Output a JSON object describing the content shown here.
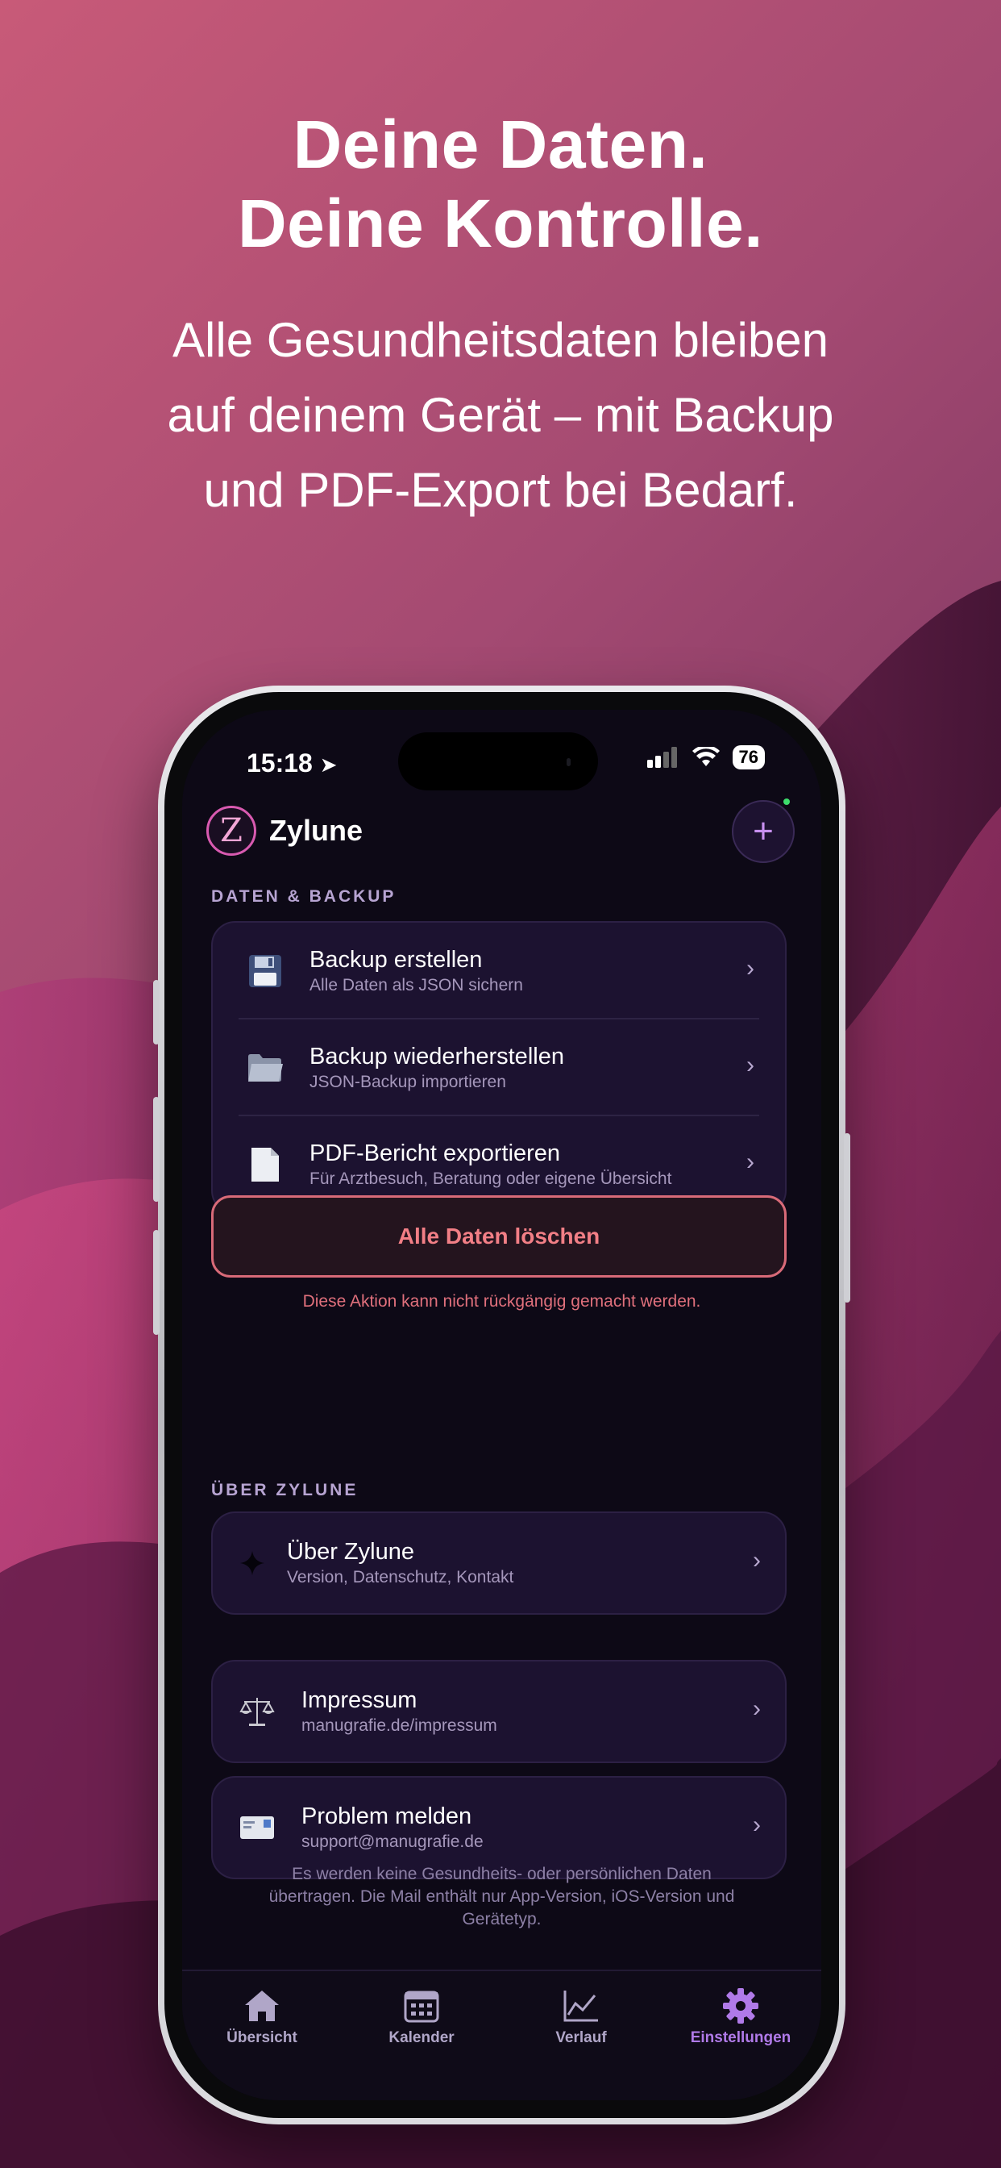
{
  "promo": {
    "headline_line1": "Deine Daten.",
    "headline_line2": "Deine Kontrolle.",
    "subline_line1": "Alle Gesundheitsdaten bleiben",
    "subline_line2": "auf deinem Gerät – mit Backup",
    "subline_line3": "und PDF-Export bei Bedarf."
  },
  "status_bar": {
    "time": "15:18",
    "battery": "76"
  },
  "app": {
    "logo_letter": "Z",
    "title": "Zylune",
    "add_label": "+"
  },
  "data_section": {
    "label": "DATEN & BACKUP",
    "items": [
      {
        "title": "Backup erstellen",
        "subtitle": "Alle Daten als JSON sichern",
        "icon": "floppy-disk-icon"
      },
      {
        "title": "Backup wiederherstellen",
        "subtitle": "JSON-Backup importieren",
        "icon": "folder-icon"
      },
      {
        "title": "PDF-Bericht exportieren",
        "subtitle": "Für Arztbesuch, Beratung oder eigene Übersicht",
        "icon": "document-icon"
      }
    ]
  },
  "danger": {
    "delete_label": "Alle Daten löschen",
    "delete_note": "Diese Aktion kann nicht rückgängig gemacht werden.",
    "color": "#f27f86"
  },
  "about_section": {
    "label": "ÜBER ZYLUNE",
    "about": {
      "title": "Über Zylune",
      "subtitle": "Version, Datenschutz, Kontakt",
      "icon": "sparkle-icon"
    },
    "imprint": {
      "title": "Impressum",
      "subtitle": "manugrafie.de/impressum",
      "icon": "scales-icon"
    },
    "report": {
      "title": "Problem melden",
      "subtitle": "support@manugrafie.de",
      "icon": "envelope-icon"
    },
    "note_line1": "Es werden keine Gesundheits- oder persönlichen Daten",
    "note_line2": "übertragen. Die Mail enthält nur App-Version, iOS-Version und",
    "note_line3": "Gerätetyp."
  },
  "tabs": [
    {
      "label": "Übersicht",
      "icon": "house-icon"
    },
    {
      "label": "Kalender",
      "icon": "calendar-icon"
    },
    {
      "label": "Verlauf",
      "icon": "chart-line-icon"
    },
    {
      "label": "Einstellungen",
      "icon": "gear-icon",
      "active": true
    }
  ],
  "colors": {
    "accent": "#b07ae8",
    "background": "#0d0916",
    "card": "#1c1230"
  }
}
